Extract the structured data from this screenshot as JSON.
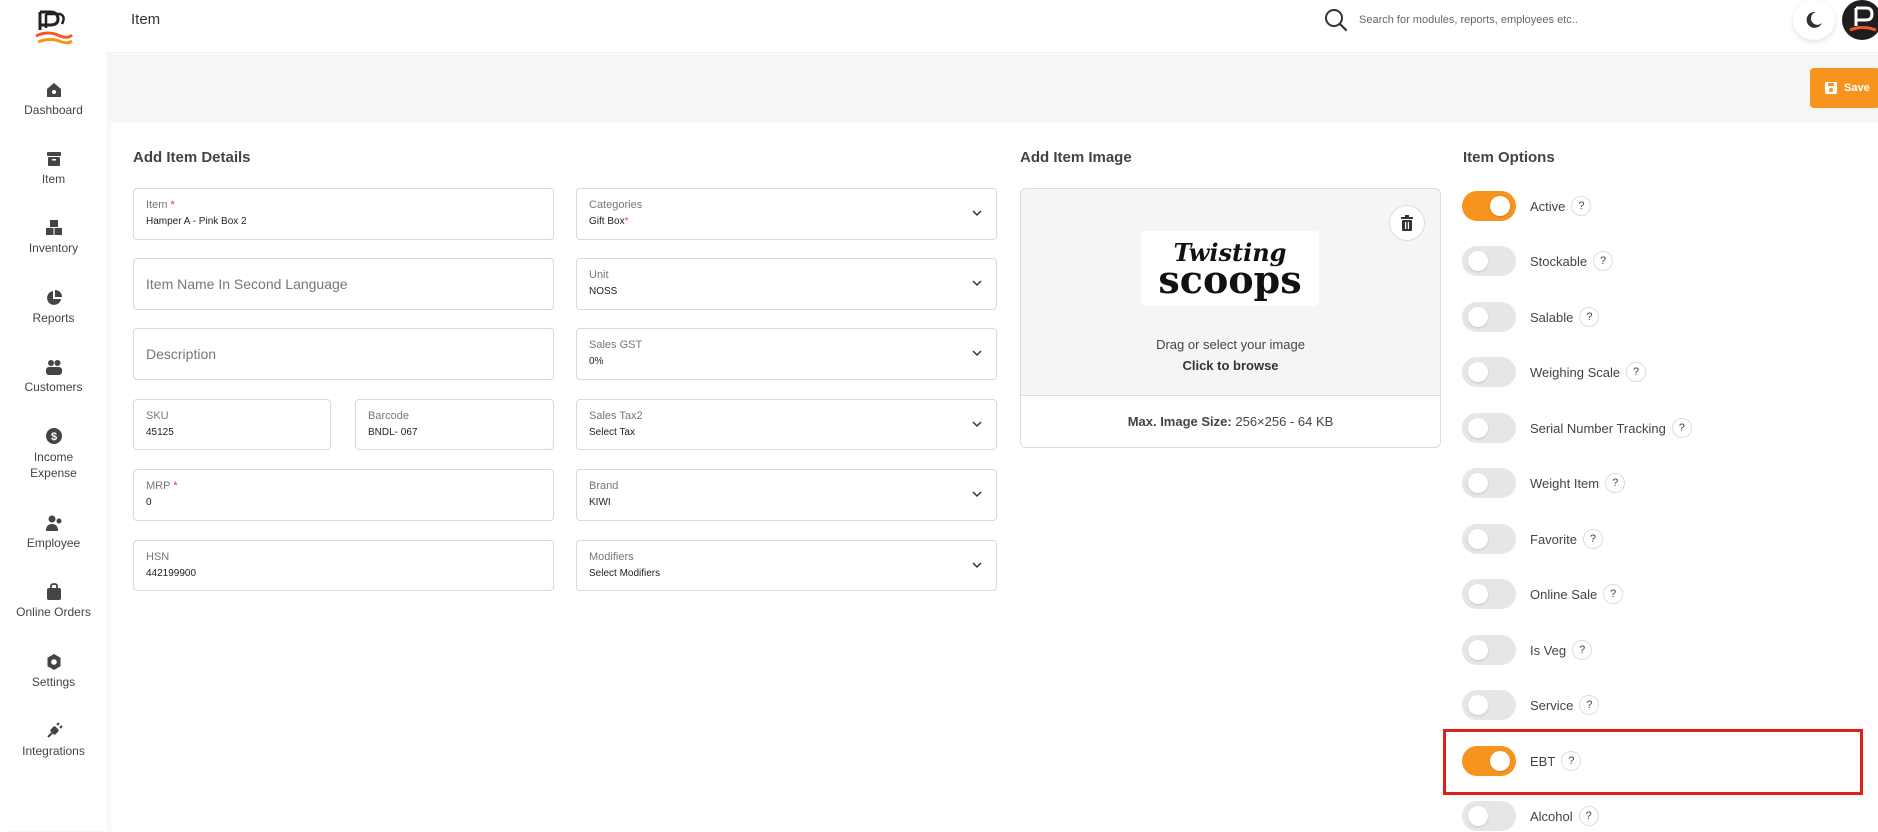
{
  "sidebar": {
    "items": [
      {
        "label": "Dashboard",
        "icon": "home-icon"
      },
      {
        "label": "Item",
        "icon": "box-icon"
      },
      {
        "label": "Inventory",
        "icon": "inventory-icon"
      },
      {
        "label": "Reports",
        "icon": "pie-chart-icon"
      },
      {
        "label": "Customers",
        "icon": "users-icon"
      },
      {
        "label": "Income\nExpense",
        "icon": "dollar-icon"
      },
      {
        "label": "Employee",
        "icon": "employee-icon"
      },
      {
        "label": "Online Orders",
        "icon": "bag-icon"
      },
      {
        "label": "Settings",
        "icon": "gear-icon"
      },
      {
        "label": "Integrations",
        "icon": "plug-icon"
      }
    ]
  },
  "header": {
    "title": "Item",
    "search_placeholder": "Search for modules, reports, employees etc.."
  },
  "toolbar": {
    "save_label": "Save"
  },
  "details": {
    "title": "Add Item Details",
    "item_label": "Item",
    "item_value": "Hamper A - Pink Box 2",
    "second_lang_placeholder": "Item Name In Second Language",
    "description_placeholder": "Description",
    "sku_label": "SKU",
    "sku_value": "45125",
    "barcode_label": "Barcode",
    "barcode_value": "BNDL- 067",
    "mrp_label": "MRP",
    "mrp_value": "0",
    "hsn_label": "HSN",
    "hsn_value": "442199900",
    "categories_label": "Categories",
    "categories_value": "Gift Box",
    "unit_label": "Unit",
    "unit_value": "NOSS",
    "sales_gst_label": "Sales GST",
    "sales_gst_value": "0%",
    "sales_tax2_label": "Sales Tax2",
    "sales_tax2_value": "Select Tax",
    "brand_label": "Brand",
    "brand_value": "KIWI",
    "modifiers_label": "Modifiers",
    "modifiers_value": "Select Modifiers",
    "required_mark": "*"
  },
  "image": {
    "title": "Add Item Image",
    "logo_text_1": "Twisting",
    "logo_text_2": "scoops",
    "drag_text": "Drag or select your image",
    "browse_text": "Click to browse",
    "max_label": "Max. Image Size:",
    "max_value": "256×256 - 64 KB"
  },
  "options": {
    "title": "Item Options",
    "help_glyph": "?",
    "items": [
      {
        "label": "Active",
        "on": true
      },
      {
        "label": "Stockable",
        "on": false
      },
      {
        "label": "Salable",
        "on": false
      },
      {
        "label": "Weighing Scale",
        "on": false
      },
      {
        "label": "Serial Number Tracking",
        "on": false
      },
      {
        "label": "Weight Item",
        "on": false
      },
      {
        "label": "Favorite",
        "on": false
      },
      {
        "label": "Online Sale",
        "on": false
      },
      {
        "label": "Is Veg",
        "on": false
      },
      {
        "label": "Service",
        "on": false
      },
      {
        "label": "EBT",
        "on": true
      },
      {
        "label": "Alcohol",
        "on": false
      }
    ]
  },
  "colors": {
    "accent": "#f7941d",
    "highlight": "#e0201b"
  }
}
